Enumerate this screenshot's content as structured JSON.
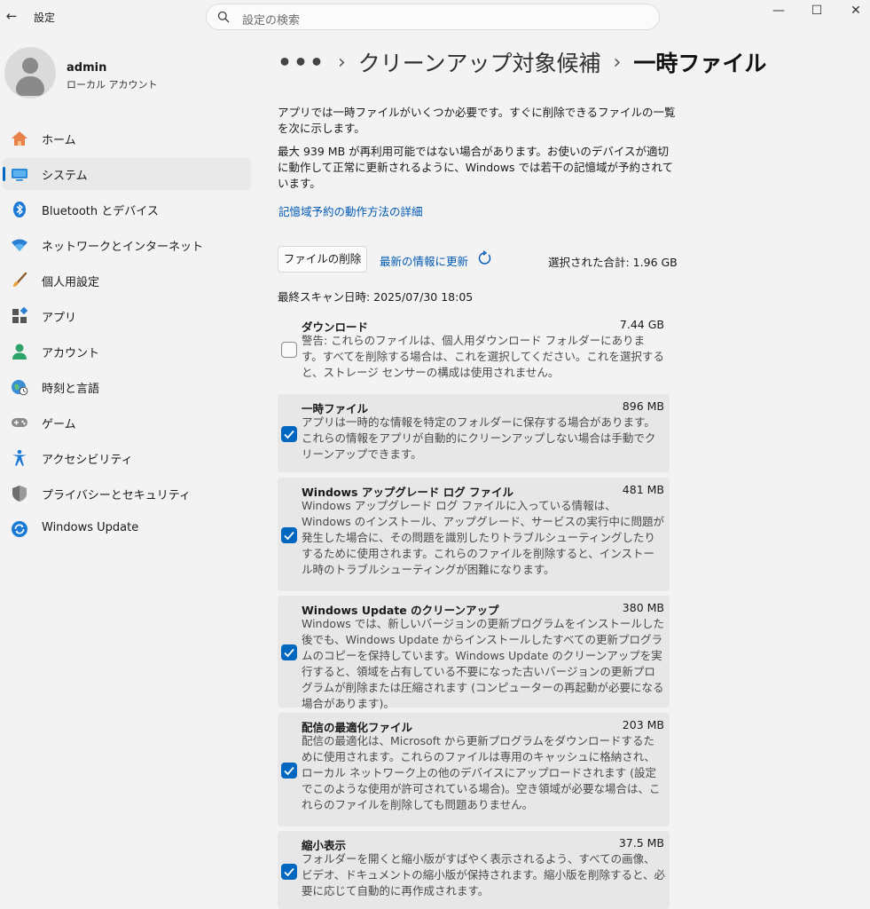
{
  "window": {
    "title": "設定",
    "back_icon": "←",
    "minimize_icon": "—",
    "maximize_icon": "☐",
    "close_icon": "✕"
  },
  "search": {
    "placeholder": "設定の検索"
  },
  "account": {
    "name": "admin",
    "type": "ローカル アカウント"
  },
  "nav": {
    "items": [
      {
        "label": "ホーム",
        "icon": "home-icon"
      },
      {
        "label": "システム",
        "icon": "system-icon"
      },
      {
        "label": "Bluetooth とデバイス",
        "icon": "bluetooth-icon"
      },
      {
        "label": "ネットワークとインターネット",
        "icon": "wifi-icon"
      },
      {
        "label": "個人用設定",
        "icon": "brush-icon"
      },
      {
        "label": "アプリ",
        "icon": "apps-icon"
      },
      {
        "label": "アカウント",
        "icon": "account-icon"
      },
      {
        "label": "時刻と言語",
        "icon": "time-language-icon"
      },
      {
        "label": "ゲーム",
        "icon": "gamepad-icon"
      },
      {
        "label": "アクセシビリティ",
        "icon": "accessibility-icon"
      },
      {
        "label": "プライバシーとセキュリティ",
        "icon": "shield-icon"
      },
      {
        "label": "Windows Update",
        "icon": "windows-update-icon"
      }
    ],
    "active": "システム"
  },
  "breadcrumb": {
    "more": "•••",
    "sep": "›",
    "parent": "クリーンアップ対象候補",
    "current": "一時ファイル"
  },
  "intro": {
    "p1": "アプリでは一時ファイルがいくつか必要です。すぐに削除できるファイルの一覧を次に示します。",
    "p2": "最大 939 MB が再利用可能ではない場合があります。お使いのデバイスが適切に動作して正常に更新されるように、Windows では若干の記憶域が予約されています。",
    "link": "記憶域予約の動作方法の詳細"
  },
  "actions": {
    "delete_label": "ファイルの削除",
    "refresh_label": "最新の情報に更新",
    "total": "選択された合計: 1.96 GB"
  },
  "last_scan": "最終スキャン日時: 2025/07/30 18:05",
  "files": [
    {
      "name": "ダウンロード",
      "size": "7.44 GB",
      "checked": false,
      "desc": "警告: これらのファイルは、個人用ダウンロード フォルダーにあります。すべてを削除する場合は、これを選択してください。これを選択すると、ストレージ センサーの構成は使用されません。"
    },
    {
      "name": "一時ファイル",
      "size": "896 MB",
      "checked": true,
      "desc": "アプリは一時的な情報を特定のフォルダーに保存する場合があります。これらの情報をアプリが自動的にクリーンアップしない場合は手動でクリーンアップできます。"
    },
    {
      "name": "Windows アップグレード ログ ファイル",
      "size": "481 MB",
      "checked": true,
      "desc": "Windows アップグレード ログ ファイルに入っている情報は、Windows のインストール、アップグレード、サービスの実行中に問題が発生した場合に、その問題を識別したりトラブルシューティングしたりするために使用されます。これらのファイルを削除すると、インストール時のトラブルシューティングが困難になります。"
    },
    {
      "name": "Windows Update のクリーンアップ",
      "size": "380 MB",
      "checked": true,
      "desc": "Windows では、新しいバージョンの更新プログラムをインストールした後でも、Windows Update からインストールしたすべての更新プログラムのコピーを保持しています。Windows Update のクリーンアップを実行すると、領域を占有している不要になった古いバージョンの更新プログラムが削除または圧縮されます (コンピューターの再起動が必要になる場合があります)。"
    },
    {
      "name": "配信の最適化ファイル",
      "size": "203 MB",
      "checked": true,
      "desc": "配信の最適化は、Microsoft から更新プログラムをダウンロードするために使用されます。これらのファイルは専用のキャッシュに格納され、ローカル ネットワーク上の他のデバイスにアップロードされます (設定でこのような使用が許可されている場合)。空き領域が必要な場合は、これらのファイルを削除しても問題ありません。"
    },
    {
      "name": "縮小表示",
      "size": "37.5 MB",
      "checked": true,
      "desc": "フォルダーを開くと縮小版がすばやく表示されるよう、すべての画像、ビデオ、ドキュメントの縮小版が保持されます。縮小版を削除すると、必要に応じて自動的に再作成されます。"
    }
  ]
}
